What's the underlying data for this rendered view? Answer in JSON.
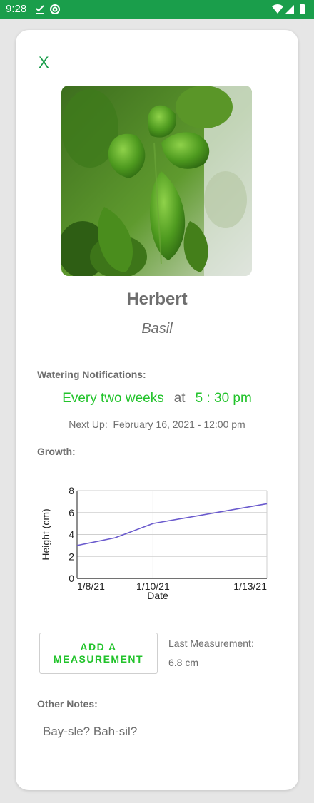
{
  "status_bar": {
    "time": "9:28",
    "icons": [
      "check-download-icon",
      "at-sign-icon",
      "wifi-icon",
      "signal-icon",
      "battery-icon"
    ]
  },
  "close_label": "X",
  "plant": {
    "name": "Herbert",
    "species": "Basil",
    "photo_alt": "basil-photo"
  },
  "watering": {
    "label": "Watering Notifications:",
    "frequency": "Every two weeks",
    "at": "at",
    "time": "5 : 30 pm",
    "next_label": "Next Up:",
    "next_value": "February 16, 2021 - 12:00 pm"
  },
  "growth": {
    "label": "Growth:"
  },
  "chart_data": {
    "type": "line",
    "xlabel": "Date",
    "ylabel": "Height (cm)",
    "x_ticks": [
      "1/8/21",
      "1/10/21",
      "1/13/21"
    ],
    "y_ticks": [
      "0",
      "2",
      "4",
      "6",
      "8"
    ],
    "ylim": [
      0,
      8
    ],
    "xlim": [
      "2021-01-08",
      "2021-01-13"
    ],
    "grid": true,
    "series": [
      {
        "x": [
          "2021-01-08",
          "2021-01-09",
          "2021-01-10",
          "2021-01-13"
        ],
        "values": [
          3.0,
          3.7,
          5.0,
          6.8
        ],
        "color": "#6a5acd"
      }
    ]
  },
  "measurement": {
    "button_label": "ADD A MEASUREMENT",
    "last_label": "Last Measurement:",
    "last_value": "6.8 cm"
  },
  "notes": {
    "label": "Other Notes:",
    "text": "Bay-sle? Bah-sil?"
  },
  "colors": {
    "header_green": "#1a9e4b",
    "accent_green": "#22c32b",
    "text_gray": "#6e6e6e",
    "line": "#6a5acd"
  }
}
